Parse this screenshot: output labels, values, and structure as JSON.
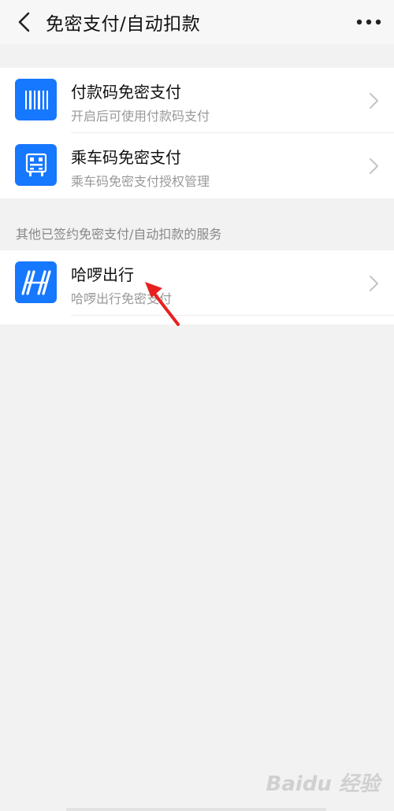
{
  "header": {
    "title": "免密支付/自动扣款",
    "back_icon": "chevron-left-icon",
    "more_icon": "more-dots-icon"
  },
  "primary_items": [
    {
      "title": "付款码免密支付",
      "subtitle": "开启后可使用付款码支付",
      "icon": "barcode-icon"
    },
    {
      "title": "乘车码免密支付",
      "subtitle": "乘车码免密支付授权管理",
      "icon": "bus-code-icon"
    }
  ],
  "section": {
    "label": "其他已签约免密支付/自动扣款的服务"
  },
  "service_items": [
    {
      "title": "哈啰出行",
      "subtitle": "哈啰出行免密支付",
      "icon": "hellobike-logo-icon"
    }
  ],
  "colors": {
    "accent": "#1677ff",
    "annotation_arrow": "#e8201f"
  },
  "watermark": {
    "text": "Baidu 经验"
  }
}
